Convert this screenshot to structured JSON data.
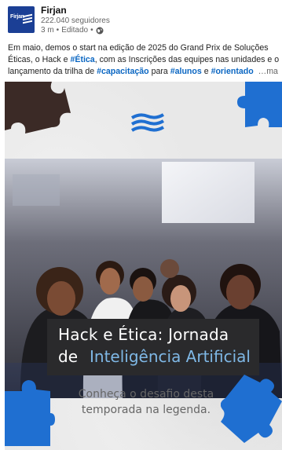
{
  "post": {
    "author": "Firjan",
    "followers": "222.040 seguidores",
    "time": "3 m",
    "edited": "Editado",
    "separator": "•",
    "logo_text": "Firjan",
    "text": {
      "part1": "Em maio, demos o start na edição de 2025 do Grand Prix de Soluções Éticas, o Hack e ",
      "tag1": "#Ética",
      "part2": ", com as Inscrições das equipes nas unidades e o lançamento da trilha de ",
      "tag2": "#capacitação",
      "part3": " para ",
      "tag3": "#alunos",
      "part4": " e ",
      "tag4": "#orientado",
      "more": "…ma"
    }
  },
  "card": {
    "title_line1": "Hack e Ética: Jornada",
    "title_line2_prefix": "de",
    "title_line2_highlight": "Inteligência Artificial",
    "subtitle": "Conheça o desafio desta temporada na legenda.",
    "colors": {
      "puzzle_dark": "#3b2a26",
      "puzzle_blue": "#1f6fd1",
      "highlight": "#7fb8e6",
      "title_box": "#2a2a2c",
      "brand_blue": "#1b3f95"
    }
  }
}
